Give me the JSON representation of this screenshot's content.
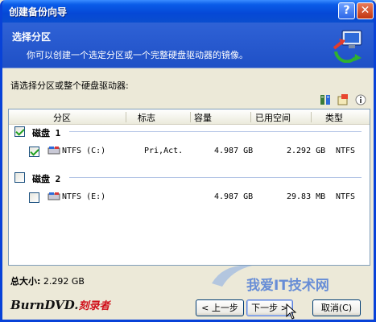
{
  "window": {
    "title": "创建备份向导",
    "help_glyph": "?",
    "close_glyph": "✕"
  },
  "header": {
    "title": "选择分区",
    "description": "你可以创建一个选定分区或一个完整硬盘驱动器的镜像。",
    "icon": "backup-wizard-icon"
  },
  "prompt": "请选择分区或整个硬盘驱动器:",
  "toolbar_icons": [
    "view-details-icon",
    "properties-icon",
    "info-icon"
  ],
  "columns": [
    "分区",
    "标志",
    "容量",
    "已用空间",
    "类型"
  ],
  "disks": [
    {
      "label": "磁盘 1",
      "checked": true,
      "partitions": [
        {
          "name": "NTFS (C:)",
          "flags": "Pri,Act.",
          "capacity": "4.987 GB",
          "used": "2.292 GB",
          "type": "NTFS",
          "checked": true
        }
      ]
    },
    {
      "label": "磁盘 2",
      "checked": false,
      "partitions": [
        {
          "name": "NTFS (E:)",
          "flags": "",
          "capacity": "4.987 GB",
          "used": "29.83 MB",
          "type": "NTFS",
          "checked": false
        }
      ]
    }
  ],
  "total": {
    "label": "总大小:",
    "value": "2.292 GB"
  },
  "buttons": {
    "back": "< 上一步",
    "next": "下一步 >",
    "cancel": "取消(C)"
  },
  "logo": {
    "text": "BurnDVD.",
    "cn": "刻录者"
  },
  "watermark": "我爱IT技术网",
  "colors": {
    "title_bar": "#0A5CE8",
    "header": "#2F62D6",
    "check": "#21A121"
  }
}
